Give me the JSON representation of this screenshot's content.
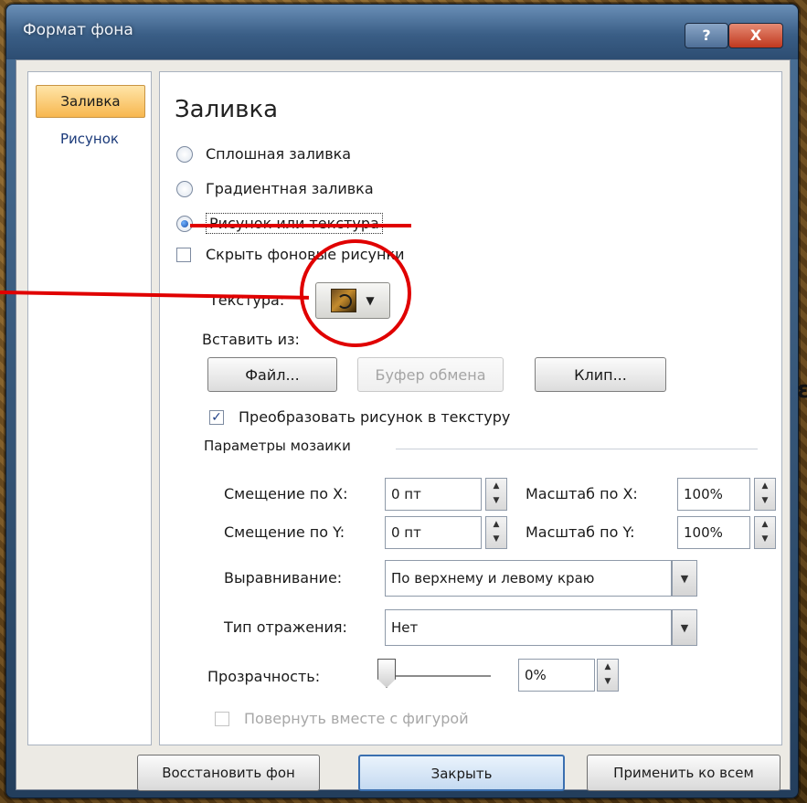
{
  "window": {
    "title": "Формат фона",
    "help_label": "?",
    "close_label": "X"
  },
  "nav": {
    "items": [
      {
        "label": "Заливка",
        "active": true
      },
      {
        "label": "Рисунок",
        "active": false
      }
    ]
  },
  "fill": {
    "heading": "Заливка",
    "options": [
      {
        "label": "Сплошная заливка",
        "selected": false
      },
      {
        "label": "Градиентная заливка",
        "selected": false
      },
      {
        "label": "Рисунок или текстура",
        "selected": true
      }
    ],
    "hide_bg_label": "Скрыть фоновые рисунки",
    "hide_bg_checked": false,
    "texture_label": "Текстура:",
    "insert_from_label": "Вставить из:",
    "buttons": {
      "file": "Файл...",
      "clipboard": "Буфер обмена",
      "clip": "Клип..."
    },
    "tile_label": "Преобразовать рисунок в текстуру",
    "tile_checked": true,
    "mosaic_group": "Параметры мозаики",
    "offset_x_label": "Смещение по X:",
    "offset_x_value": "0 пт",
    "offset_y_label": "Смещение по Y:",
    "offset_y_value": "0 пт",
    "scale_x_label": "Масштаб по X:",
    "scale_x_value": "100%",
    "scale_y_label": "Масштаб по Y:",
    "scale_y_value": "100%",
    "align_label": "Выравнивание:",
    "align_value": "По верхнему и левому краю",
    "mirror_label": "Тип отражения:",
    "mirror_value": "Нет",
    "transparency_label": "Прозрачность:",
    "transparency_value": "0%",
    "transparency_level": 0,
    "rotate_label": "Повернуть вместе с фигурой",
    "rotate_checked": false
  },
  "footer": {
    "reset": "Восстановить фон",
    "close": "Закрыть",
    "apply_all": "Применить ко всем"
  },
  "annotation_color": "#e00000"
}
